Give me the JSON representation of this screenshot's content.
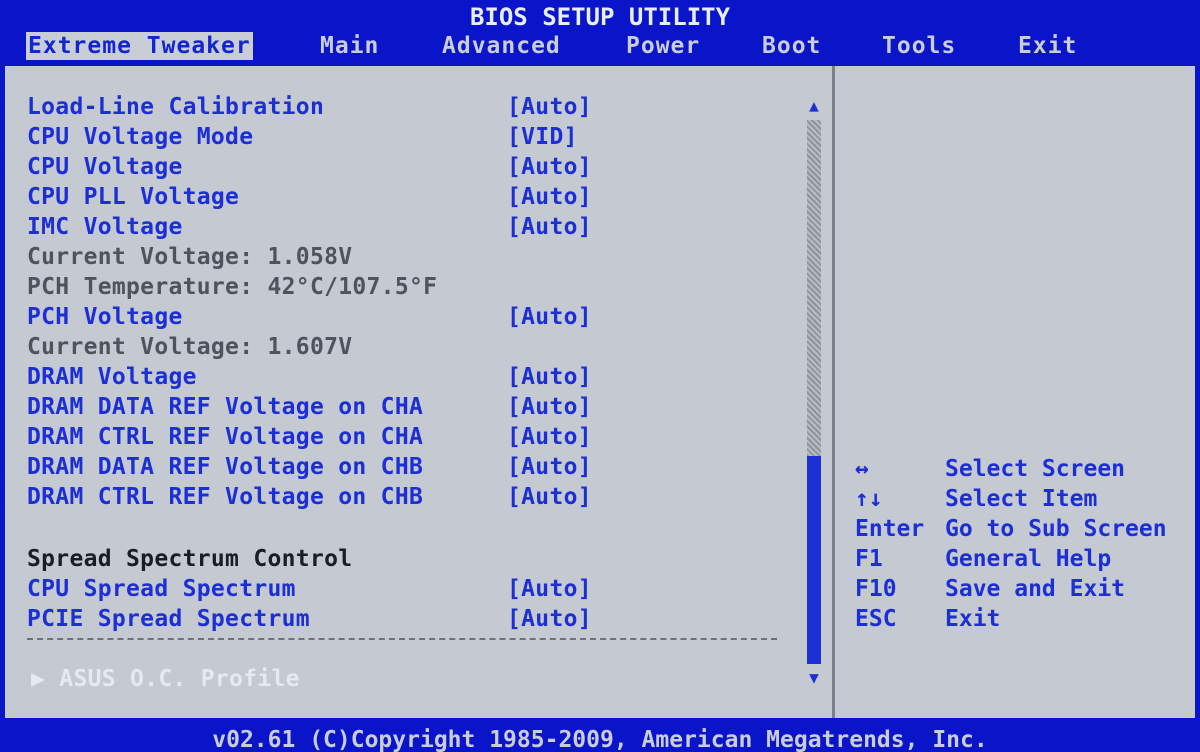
{
  "title": "BIOS SETUP UTILITY",
  "tabs": [
    {
      "label": "Extreme Tweaker",
      "active": true
    },
    {
      "label": "Main"
    },
    {
      "label": "Advanced"
    },
    {
      "label": "Power"
    },
    {
      "label": "Boot"
    },
    {
      "label": "Tools"
    },
    {
      "label": "Exit"
    }
  ],
  "settings": [
    {
      "label": "Load-Line Calibration",
      "value": "[Auto]"
    },
    {
      "label": "CPU Voltage Mode",
      "value": "[VID]"
    },
    {
      "label": "CPU Voltage",
      "value": "[Auto]"
    },
    {
      "label": "CPU PLL Voltage",
      "value": "[Auto]"
    },
    {
      "label": "IMC Voltage",
      "value": "[Auto]"
    },
    {
      "label": "Current Voltage: 1.058V"
    },
    {
      "label": "PCH Temperature: 42°C/107.5°F"
    },
    {
      "label": "PCH Voltage",
      "value": "[Auto]"
    },
    {
      "label": "Current Voltage: 1.607V"
    },
    {
      "label": "DRAM Voltage",
      "value": "[Auto]"
    },
    {
      "label": "DRAM DATA REF Voltage on CHA",
      "value": "[Auto]"
    },
    {
      "label": "DRAM CTRL REF Voltage on CHA",
      "value": "[Auto]"
    },
    {
      "label": "DRAM DATA REF Voltage on CHB",
      "value": "[Auto]"
    },
    {
      "label": "DRAM CTRL REF Voltage on CHB",
      "value": "[Auto]"
    },
    {
      "label": "Spread Spectrum Control"
    },
    {
      "label": "CPU Spread Spectrum",
      "value": "[Auto]"
    },
    {
      "label": "PCIE Spread Spectrum",
      "value": "[Auto]"
    },
    {
      "label": "▶ ASUS O.C. Profile"
    }
  ],
  "scroll": {
    "up": "▲",
    "down": "▼"
  },
  "help": [
    {
      "key": "↔",
      "desc": "Select Screen"
    },
    {
      "key": "↑↓",
      "desc": "Select Item"
    },
    {
      "key": "Enter",
      "desc": "Go to Sub Screen"
    },
    {
      "key": "F1",
      "desc": "General Help"
    },
    {
      "key": "F10",
      "desc": "Save and Exit"
    },
    {
      "key": "ESC",
      "desc": "Exit"
    }
  ],
  "footer": "v02.61 (C)Copyright 1985-2009, American Megatrends, Inc.",
  "colors": {
    "background": "#0a14c8",
    "panel": "#c4c9d2",
    "selectable_text": "#1c2fd4",
    "readonly_text": "#4e535e"
  }
}
